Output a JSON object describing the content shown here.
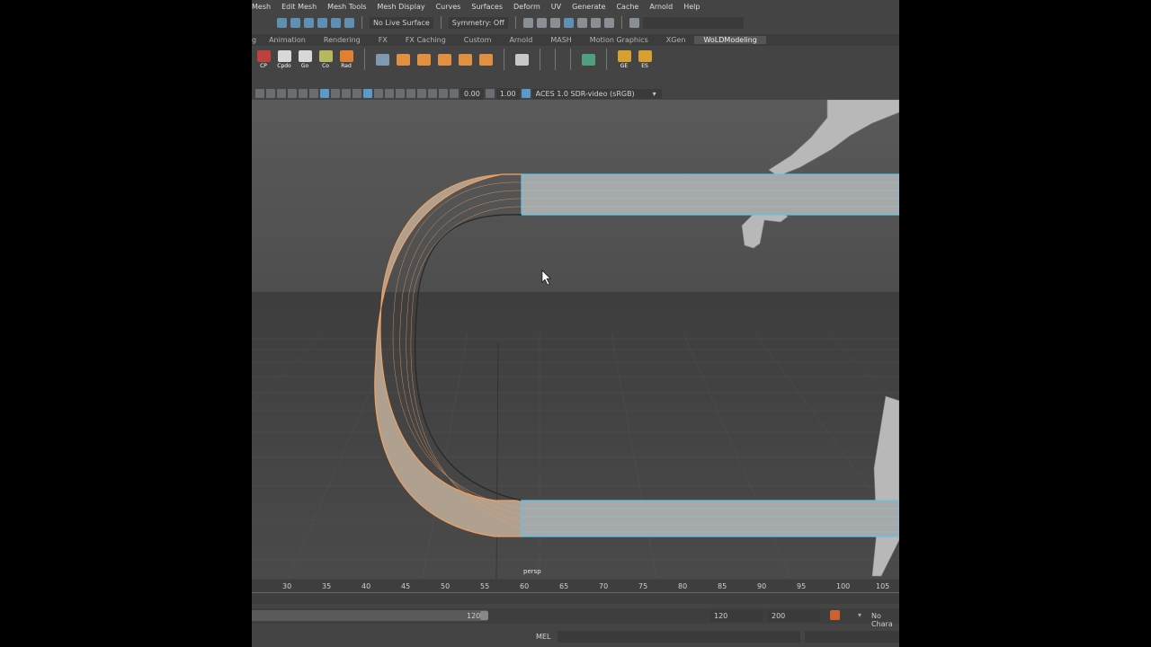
{
  "menubar": {
    "items": [
      "Mesh",
      "Edit Mesh",
      "Mesh Tools",
      "Mesh Display",
      "Curves",
      "Surfaces",
      "Deform",
      "UV",
      "Generate",
      "Cache",
      "Arnold",
      "Help"
    ]
  },
  "status": {
    "live_surface": "No Live Surface",
    "symmetry": "Symmetry: Off"
  },
  "shelf": {
    "tabs": [
      "g",
      "Animation",
      "Rendering",
      "FX",
      "FX Caching",
      "Custom",
      "Arnold",
      "MASH",
      "Motion Graphics",
      "XGen",
      "WoLDModeling"
    ],
    "active_tab": "WoLDModeling",
    "buttons": [
      "CP",
      "Cpdo",
      "Go",
      "Co",
      "Rad"
    ],
    "right_buttons": [
      "GE",
      "ES"
    ]
  },
  "panel": {
    "exposure": "0.00",
    "gamma": "1.00",
    "colorspace": "ACES 1.0 SDR-video (sRGB)"
  },
  "viewport": {
    "camera": "persp"
  },
  "timeline": {
    "ticks": [
      "30",
      "35",
      "40",
      "45",
      "50",
      "55",
      "60",
      "65",
      "70",
      "75",
      "80",
      "85",
      "90",
      "95",
      "100",
      "105"
    ]
  },
  "range": {
    "current": "120",
    "end": "120",
    "anim_end": "200",
    "character": "No Chara"
  },
  "cmdline": {
    "lang": "MEL"
  },
  "colors": {
    "accent": "#5aa0d0",
    "selection": "#f0a060",
    "app_bg": "#444444"
  }
}
